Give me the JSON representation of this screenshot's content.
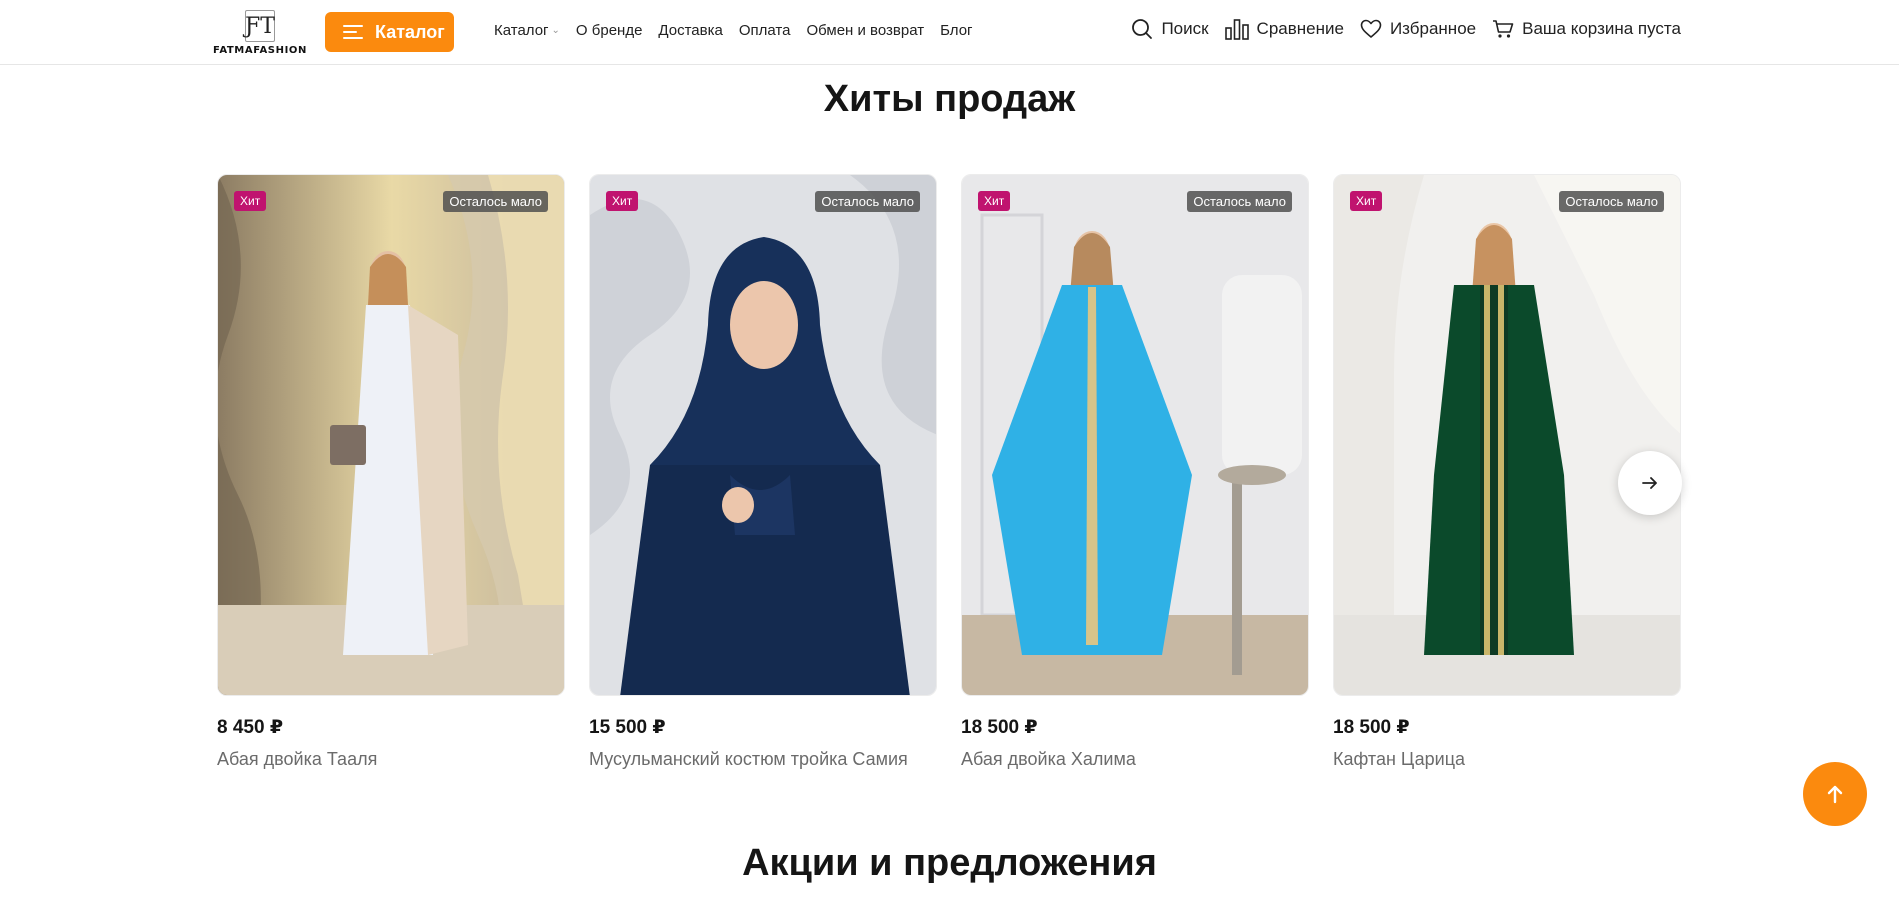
{
  "header": {
    "logo_text": "FATMAFASHION",
    "catalog_button": "Каталог",
    "nav": [
      "Каталог",
      "О бренде",
      "Доставка",
      "Оплата",
      "Обмен и возврат",
      "Блог"
    ],
    "search": "Поиск",
    "compare": "Сравнение",
    "favorites": "Избранное",
    "cart": "Ваша корзина пуста"
  },
  "hits": {
    "title": "Хиты продаж",
    "badge_hit": "Хит",
    "badge_stock": "Осталось мало",
    "products": [
      {
        "price": "8 450 ₽",
        "name": "Абая двойка Тааля"
      },
      {
        "price": "15 500 ₽",
        "name": "Мусульманский костюм тройка Самия"
      },
      {
        "price": "18 500 ₽",
        "name": "Абая двойка Халима"
      },
      {
        "price": "18 500 ₽",
        "name": "Кафтан Царица"
      }
    ]
  },
  "promos": {
    "title": "Акции и предложения"
  },
  "colors": {
    "accent": "#fb8a0e",
    "hit_badge": "#c0136f"
  }
}
